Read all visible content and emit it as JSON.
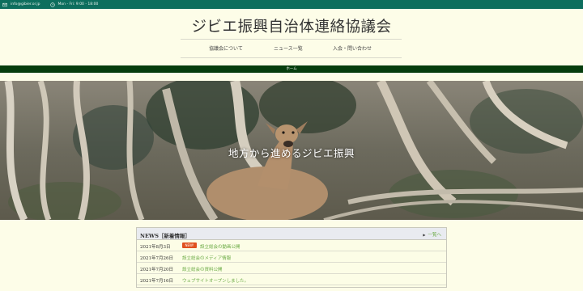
{
  "topbar": {
    "email": "info@gibier.or.jp",
    "hours": "Mon - Fri: 9:00 - 18:00"
  },
  "site": {
    "title": "ジビエ振興自治体連絡協議会"
  },
  "nav": {
    "items": [
      {
        "label": "協議会について"
      },
      {
        "label": "ニュース一覧"
      },
      {
        "label": "入会・問い合わせ"
      }
    ]
  },
  "breadcrumb": {
    "home": "ホーム"
  },
  "hero": {
    "catchphrase": "地方から進めるジビエ振興"
  },
  "news": {
    "heading": "NEWS［新着情報］",
    "more": "一覧へ",
    "items": [
      {
        "date": "2021年8月3日",
        "badge": "NEW!",
        "title": "設立総会の動画公開"
      },
      {
        "date": "2021年7月26日",
        "badge": "",
        "title": "設立総会のメディア情報"
      },
      {
        "date": "2021年7月20日",
        "badge": "",
        "title": "設立総会の資料公開"
      },
      {
        "date": "2021年7月16日",
        "badge": "",
        "title": "ウェブサイトオープンしました。"
      }
    ]
  },
  "colors": {
    "topbar": "#0d6e5e",
    "greenbar": "#063d0d",
    "page_background": "#fdfde8",
    "link": "#6aaa44",
    "badge": "#e0501f"
  }
}
